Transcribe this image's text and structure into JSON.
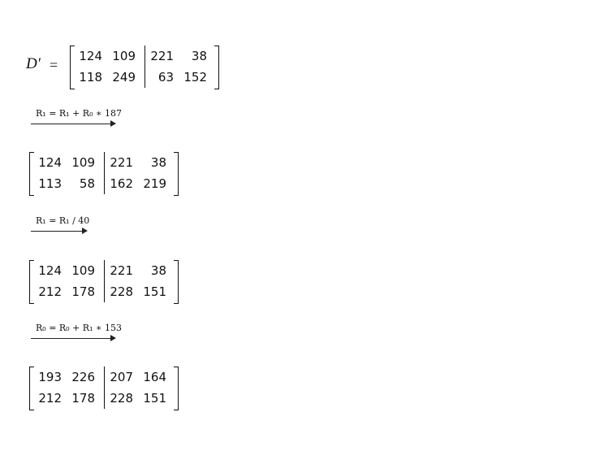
{
  "lhs_symbol": "D′",
  "equals_sign": "=",
  "matrices": [
    {
      "rows": [
        [
          "124",
          "109",
          "221",
          "38"
        ],
        [
          "118",
          "249",
          "63",
          "152"
        ]
      ]
    },
    {
      "rows": [
        [
          "124",
          "109",
          "221",
          "38"
        ],
        [
          "113",
          "58",
          "162",
          "219"
        ]
      ]
    },
    {
      "rows": [
        [
          "124",
          "109",
          "221",
          "38"
        ],
        [
          "212",
          "178",
          "228",
          "151"
        ]
      ]
    },
    {
      "rows": [
        [
          "193",
          "226",
          "207",
          "164"
        ],
        [
          "212",
          "178",
          "228",
          "151"
        ]
      ]
    }
  ],
  "operations": [
    {
      "label": "R₁ = R₁ + R₀ ∗ 187"
    },
    {
      "label": "R₁ = R₁ / 40"
    },
    {
      "label": "R₀ = R₀ + R₁ ∗ 153"
    }
  ]
}
